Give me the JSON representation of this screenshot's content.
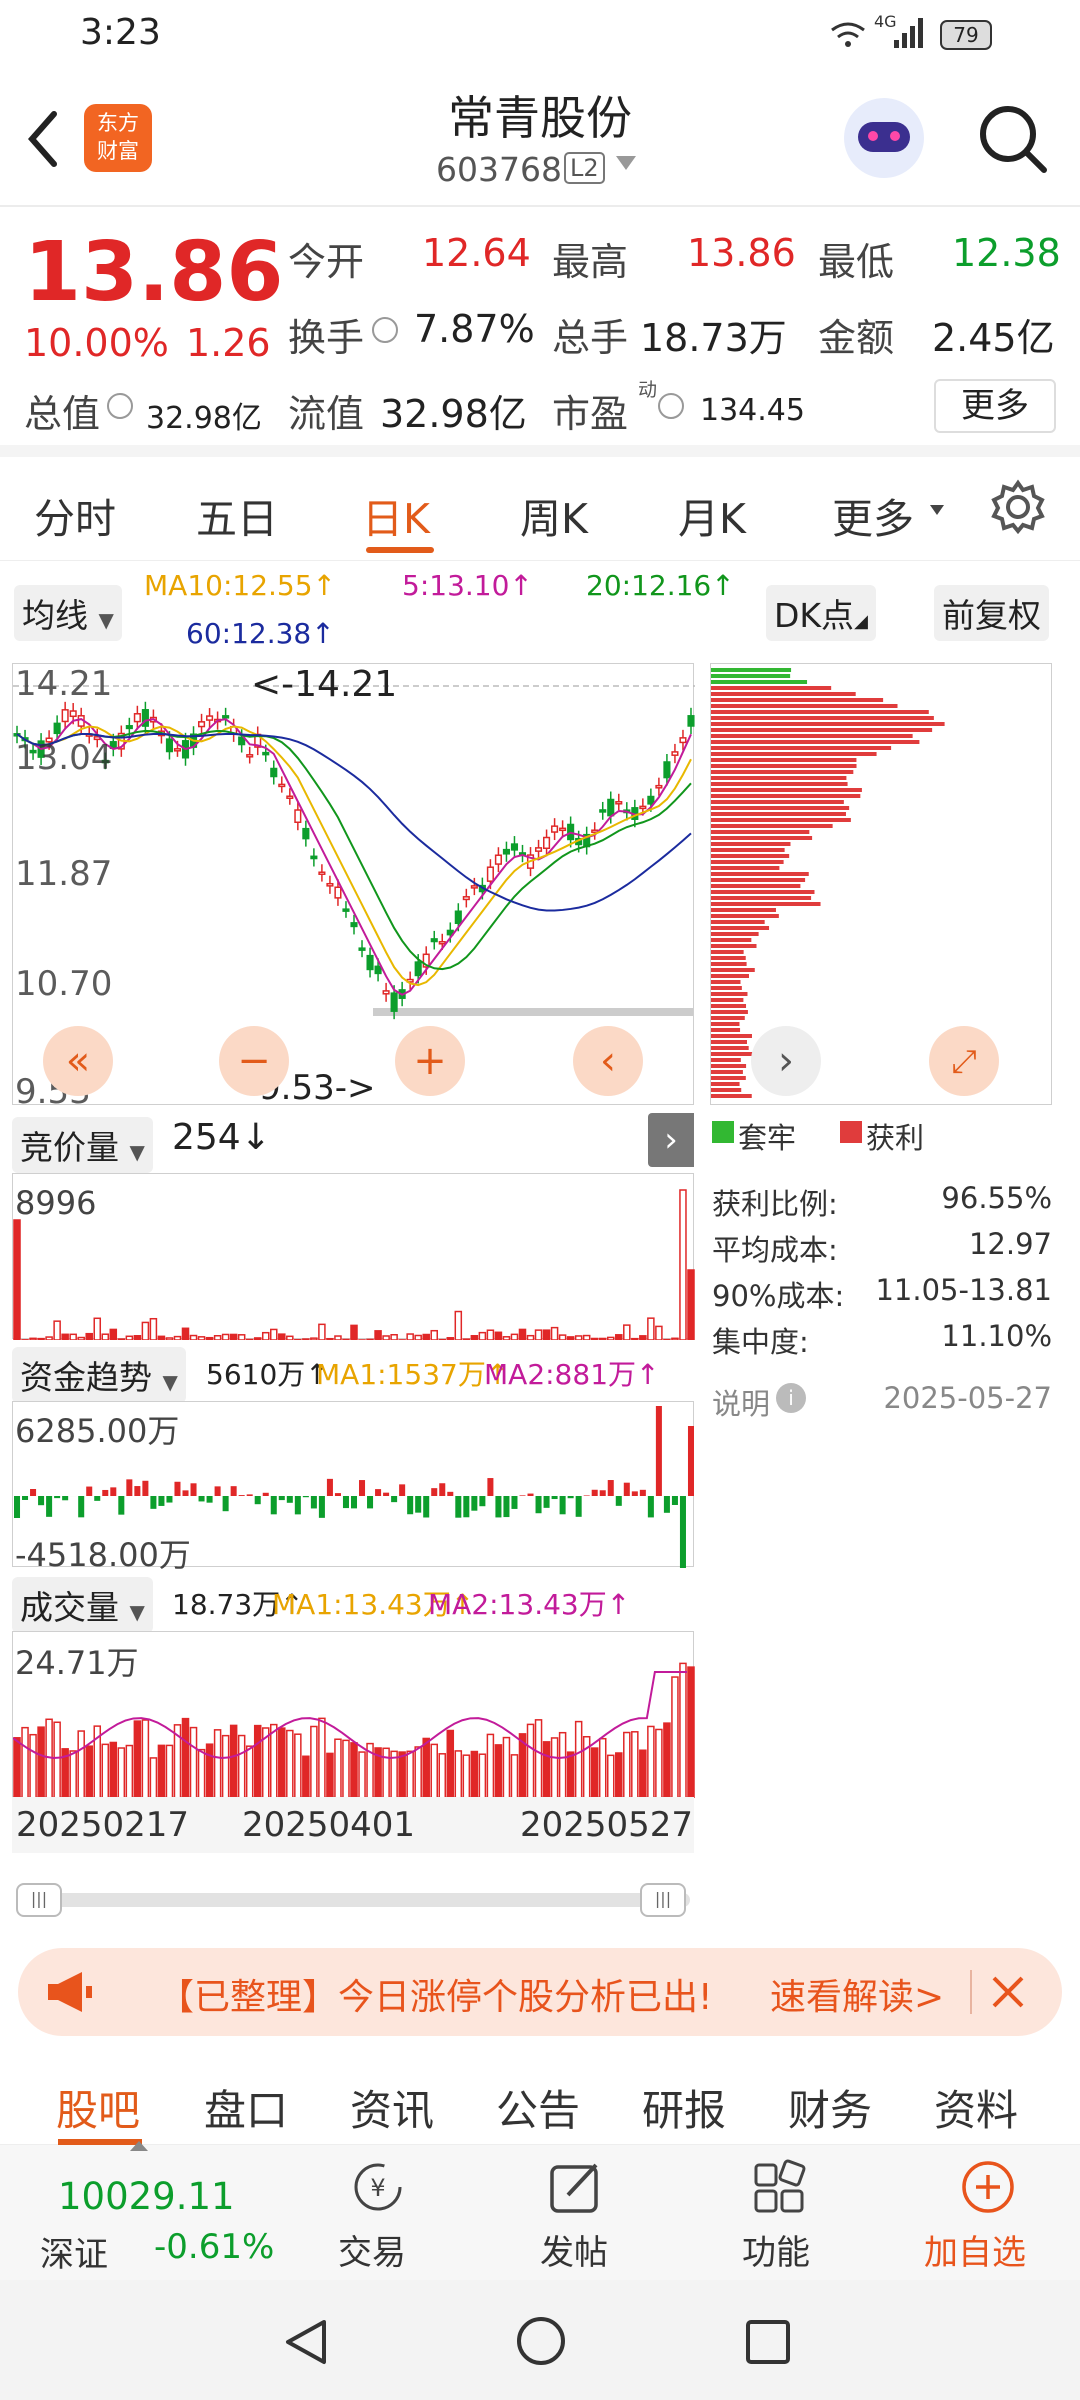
{
  "status_bar": {
    "time": "3:23",
    "network": "4G",
    "battery": "79"
  },
  "header": {
    "back_icon": "chevron-left-icon",
    "logo_text_1": "东方",
    "logo_text_2": "财富",
    "title": "常青股份",
    "code": "603768",
    "level_badge": "L2",
    "avatar_icon": "robot-avatar-icon",
    "search_icon": "search-icon"
  },
  "quote": {
    "price": "13.86",
    "change_pct": "10.00%",
    "change_amt": "1.26",
    "open_label": "今开",
    "open": "12.64",
    "high_label": "最高",
    "high": "13.86",
    "low_label": "最低",
    "low": "12.38",
    "turnover_label": "换手",
    "turnover": "7.87%",
    "vol_label": "总手",
    "vol": "18.73万",
    "amount_label": "金额",
    "amount": "2.45亿",
    "mktcap_label": "总值",
    "mktcap": "32.98亿",
    "float_label": "流值",
    "float": "32.98亿",
    "pe_label": "市盈",
    "pe_sup": "动",
    "pe": "134.45",
    "more": "更多",
    "colors": {
      "up": "#e02727",
      "down": "#0c9e2c"
    }
  },
  "tabs": {
    "items": [
      "分时",
      "五日",
      "日K",
      "周K",
      "月K",
      "更多"
    ],
    "active": "日K",
    "settings_icon": "gear-icon"
  },
  "kline": {
    "ma_selector": "均线",
    "ma10": "MA10:12.55↑",
    "ma5": "5:13.10↑",
    "ma20": "20:12.16↑",
    "ma60": "60:12.38↑",
    "dk_button": "DK点",
    "adjust_button": "前复权",
    "y_labels": [
      "14.21",
      "13.04",
      "11.87",
      "10.70",
      "9.53"
    ],
    "max_marker": "<-14.21",
    "min_marker": "9.53->"
  },
  "chips": {
    "legend_trapped": "套牢",
    "legend_profit": "获利",
    "profit_ratio_label": "获利比例:",
    "profit_ratio": "96.55%",
    "avg_cost_label": "平均成本:",
    "avg_cost": "12.97",
    "cost90_label": "90%成本:",
    "cost90": "11.05-13.81",
    "concentration_label": "集中度:",
    "concentration": "11.10%",
    "note_label": "说明",
    "date": "2025-05-27"
  },
  "auction": {
    "selector": "竞价量",
    "value": "254↓",
    "y_max": "8996"
  },
  "fund_flow": {
    "selector": "资金趋势",
    "value": "5610万↑",
    "ma1": "MA1:1537万↑",
    "ma2": "MA2:881万↑",
    "y_max": "6285.00万",
    "y_min": "-4518.00万"
  },
  "volume": {
    "selector": "成交量",
    "value": "18.73万↑",
    "ma1": "MA1:13.43万↑",
    "ma2": "MA2:13.43万↑",
    "y_max": "24.71万",
    "dates": [
      "20250217",
      "20250401",
      "20250527"
    ]
  },
  "banner": {
    "text_1": "【已整理】今日涨停个股分析已出!",
    "text_2": "速看解读>",
    "icon": "megaphone-icon",
    "close_icon": "close-icon"
  },
  "bottom_tabs": {
    "items": [
      "股吧",
      "盘口",
      "资讯",
      "公告",
      "研报",
      "财务",
      "资料"
    ],
    "active": "股吧"
  },
  "dock": {
    "index_value": "10029.11",
    "index_name": "深证",
    "index_change": "-0.61%",
    "trade": "交易",
    "post": "发帖",
    "functions": "功能",
    "add_watch": "加自选"
  }
}
